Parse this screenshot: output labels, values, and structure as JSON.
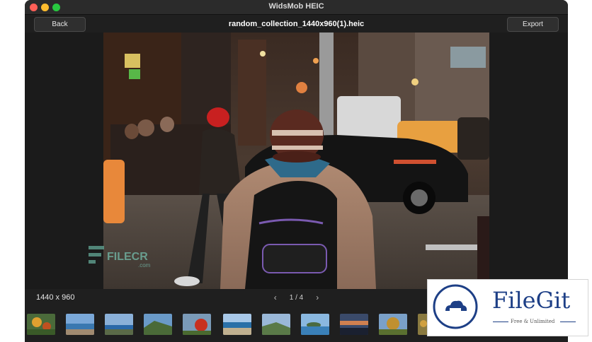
{
  "window": {
    "title": "WidsMob HEIC"
  },
  "toolbar": {
    "back_label": "Back",
    "export_label": "Export",
    "file_name": "random_collection_1440x960(1).heic"
  },
  "status": {
    "dimensions": "1440 x 960",
    "page_indicator": "1 / 4"
  },
  "icons": {
    "prev": "chevron-left-icon",
    "next": "chevron-right-icon"
  },
  "thumbnails": [
    {
      "name": "thumb-flowers-1"
    },
    {
      "name": "thumb-seaside-1"
    },
    {
      "name": "thumb-coast-1"
    },
    {
      "name": "thumb-coast-2"
    },
    {
      "name": "thumb-flowers-2"
    },
    {
      "name": "thumb-seaside-2"
    },
    {
      "name": "thumb-seaside-3"
    },
    {
      "name": "thumb-island"
    },
    {
      "name": "thumb-sunset"
    },
    {
      "name": "thumb-autumn-tree"
    },
    {
      "name": "thumb-partial"
    }
  ],
  "watermarks": {
    "filecr": "FILECR",
    "filecr_sub": ".com",
    "filegit_name": "FileGit",
    "filegit_tagline": "Free & Unlimited"
  },
  "colors": {
    "window_bg": "#1f1f1f",
    "filegit_blue": "#1d3f86"
  }
}
